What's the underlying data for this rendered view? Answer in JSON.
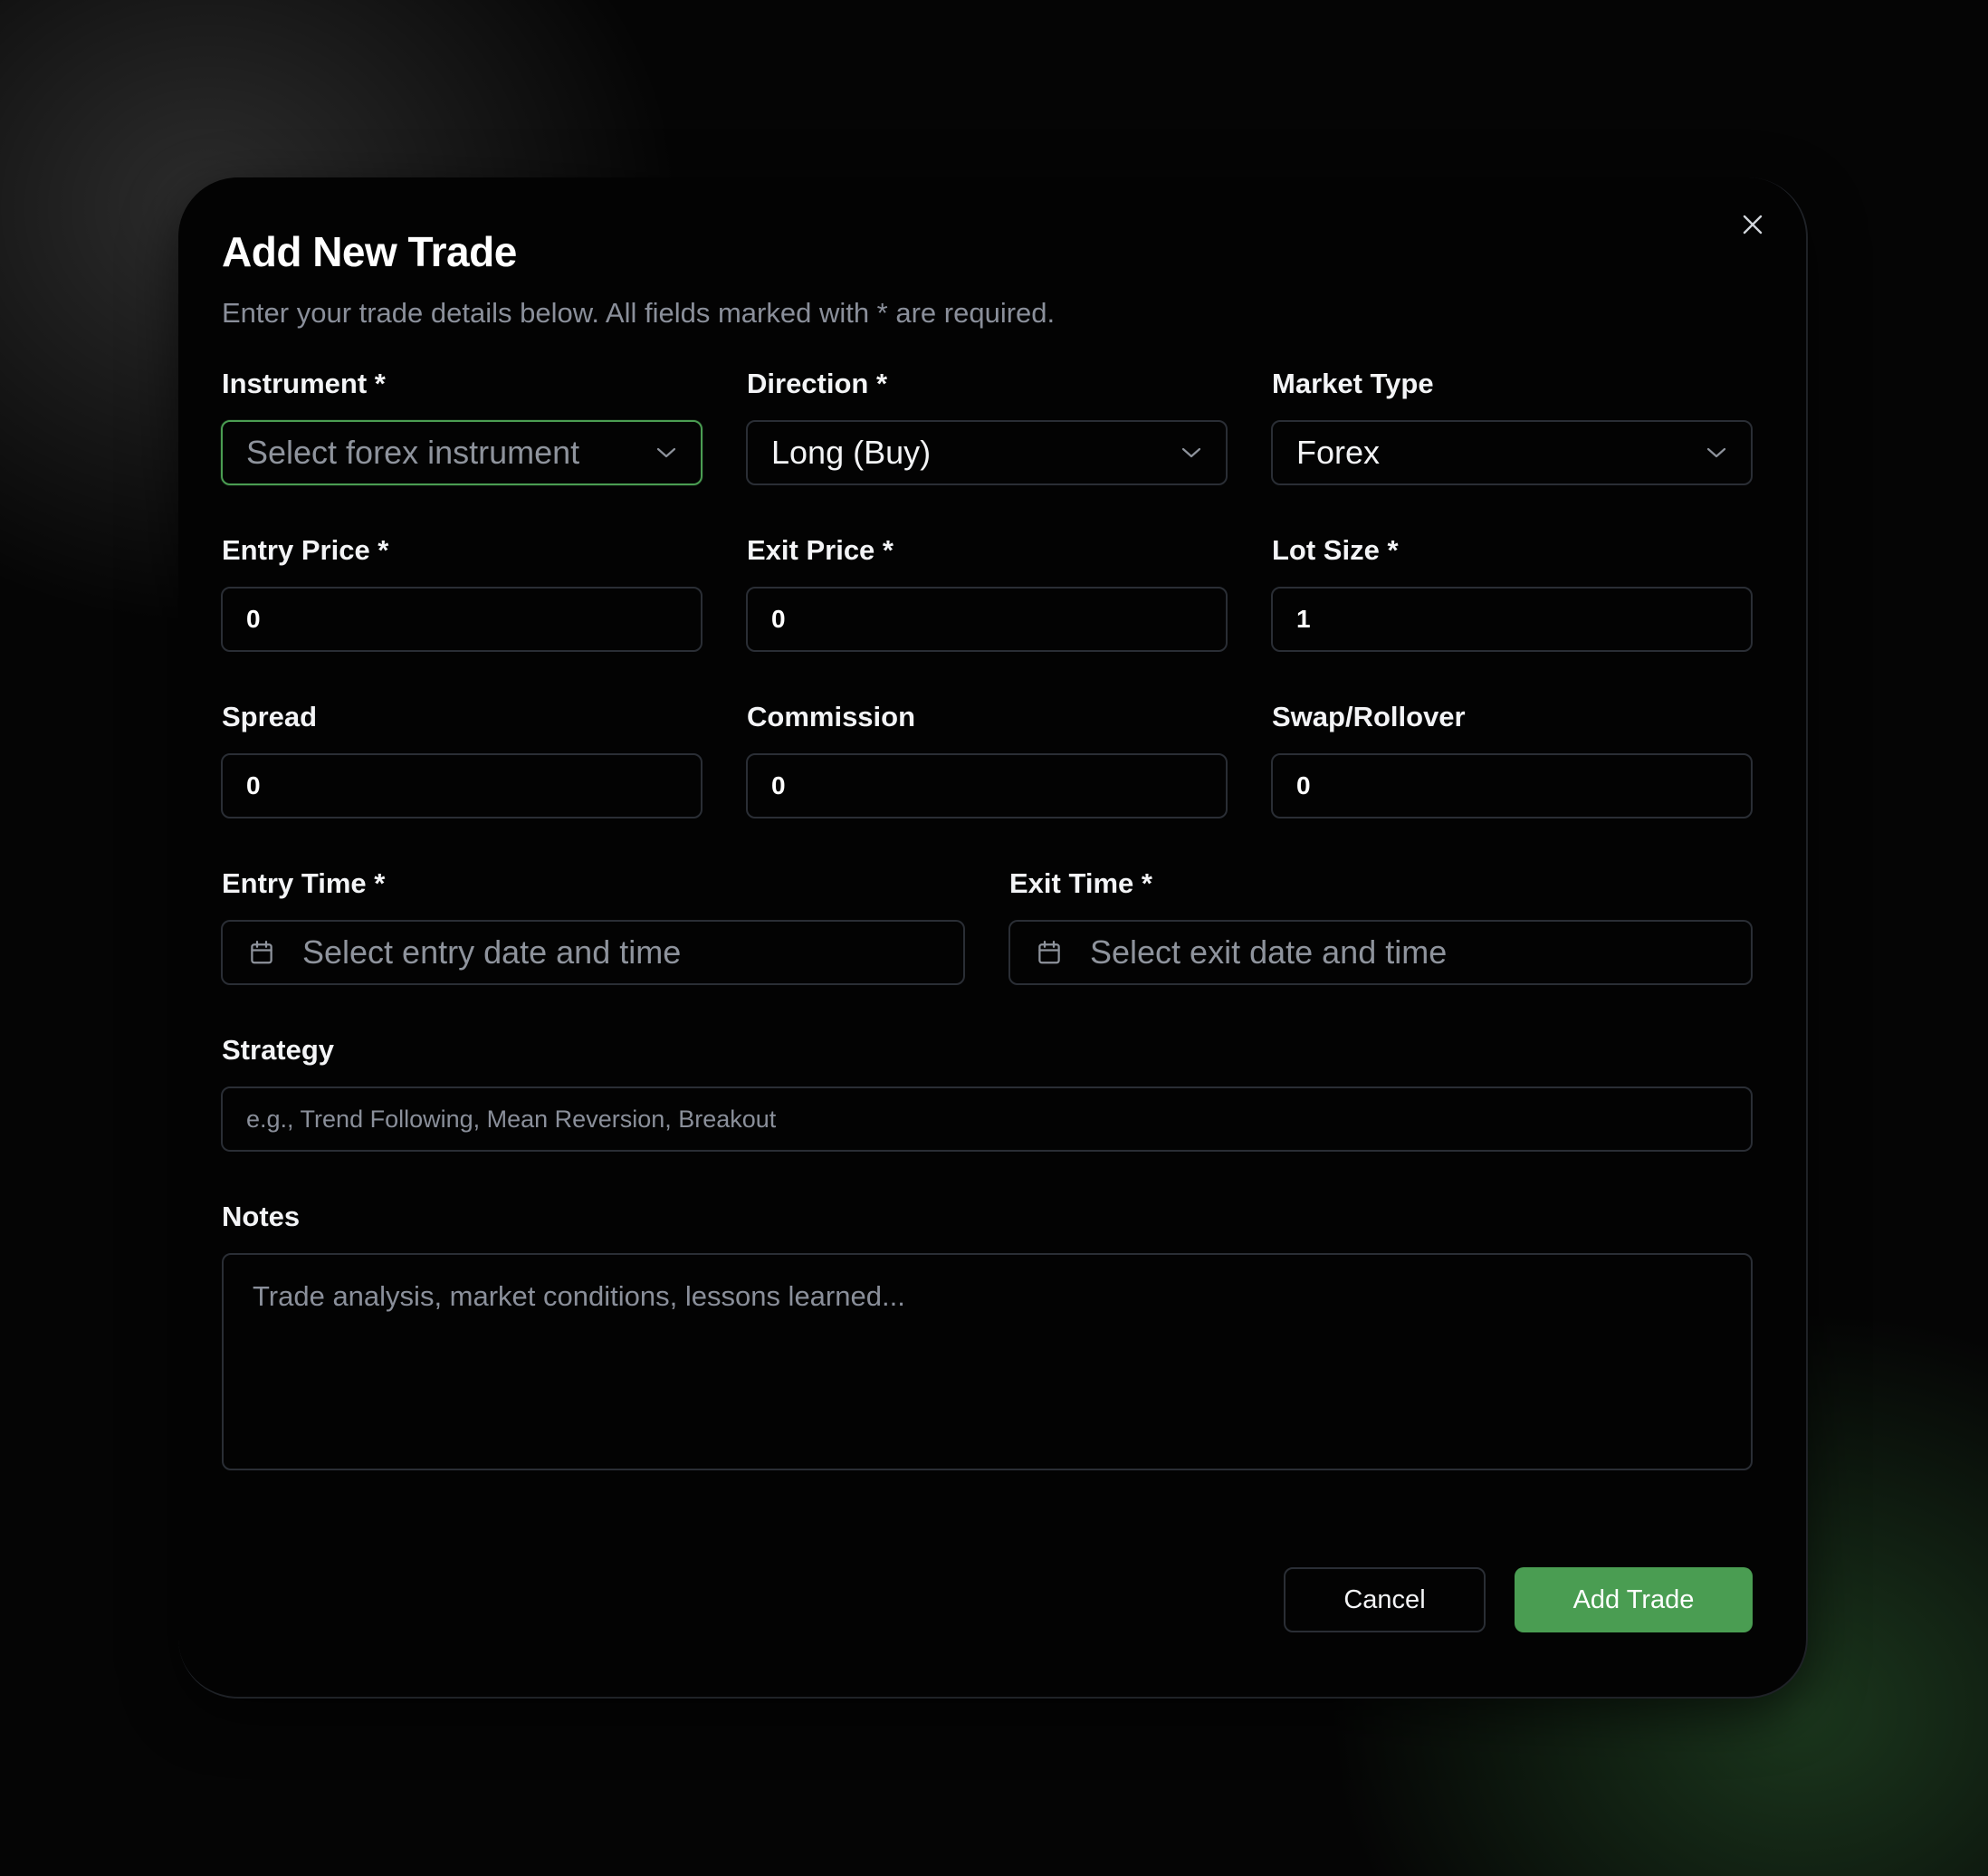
{
  "dialog": {
    "title": "Add New Trade",
    "subtitle": "Enter your trade details below. All fields marked with * are required.",
    "close_icon": "close-icon"
  },
  "fields": {
    "instrument": {
      "label": "Instrument *",
      "placeholder": "Select forex instrument"
    },
    "direction": {
      "label": "Direction *",
      "value": "Long (Buy)"
    },
    "market_type": {
      "label": "Market Type",
      "value": "Forex"
    },
    "entry_price": {
      "label": "Entry Price *",
      "value": "0"
    },
    "exit_price": {
      "label": "Exit Price *",
      "value": "0"
    },
    "lot_size": {
      "label": "Lot Size *",
      "value": "1"
    },
    "spread": {
      "label": "Spread",
      "value": "0"
    },
    "commission": {
      "label": "Commission",
      "value": "0"
    },
    "swap": {
      "label": "Swap/Rollover",
      "value": "0"
    },
    "entry_time": {
      "label": "Entry Time *",
      "placeholder": "Select entry date and time"
    },
    "exit_time": {
      "label": "Exit Time *",
      "placeholder": "Select exit date and time"
    },
    "strategy": {
      "label": "Strategy",
      "placeholder": "e.g., Trend Following, Mean Reversion, Breakout"
    },
    "notes": {
      "label": "Notes",
      "placeholder": "Trade analysis, market conditions, lessons learned..."
    }
  },
  "buttons": {
    "cancel": "Cancel",
    "add": "Add Trade"
  },
  "colors": {
    "accent": "#4a9d52",
    "background": "#030303",
    "border": "#2a2e35",
    "muted_text": "#8a8f9a"
  }
}
